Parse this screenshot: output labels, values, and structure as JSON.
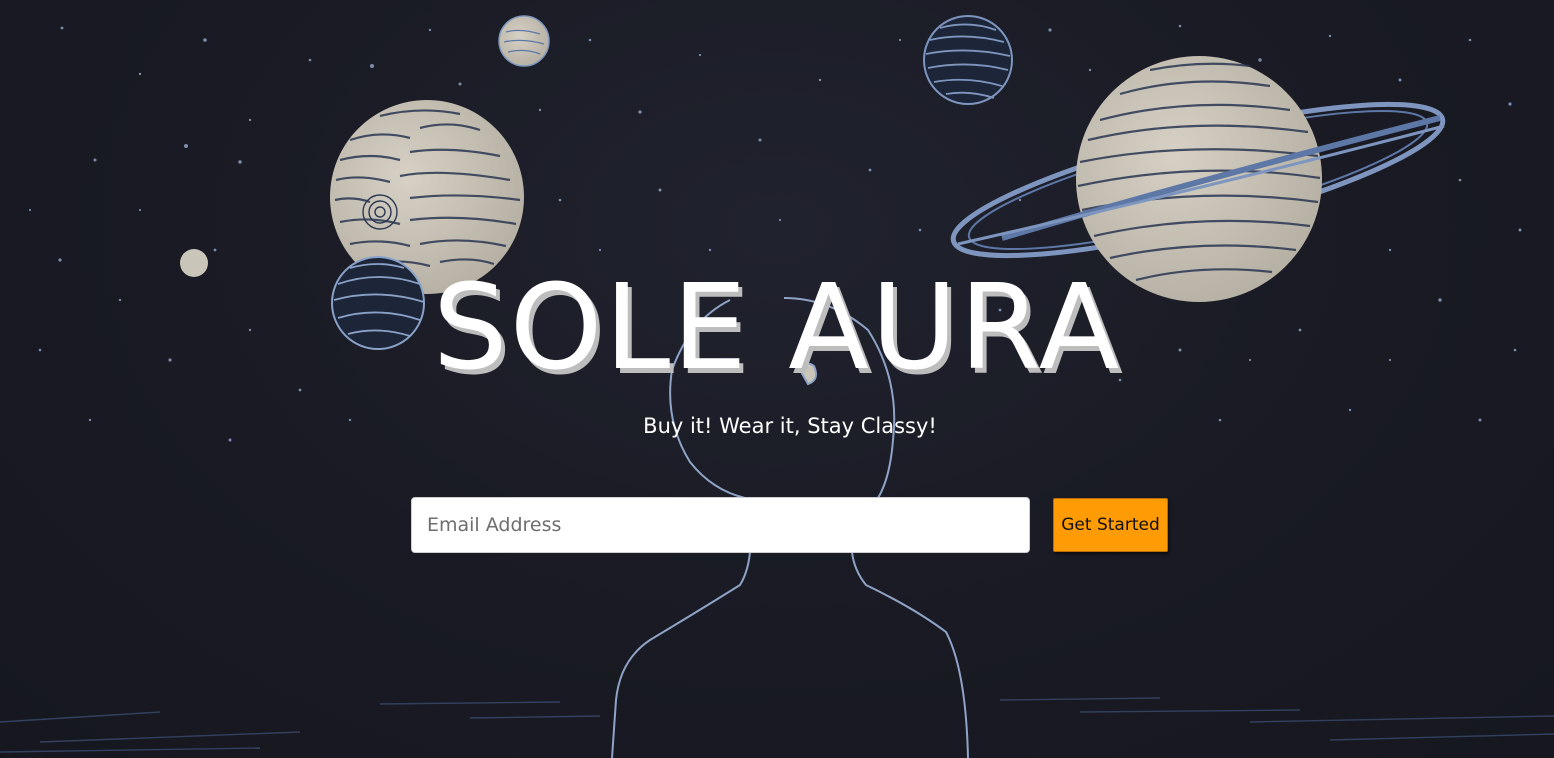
{
  "hero": {
    "title": "SOLE AURA",
    "tagline": "Buy it! Wear it, Stay Classy!",
    "email_placeholder": "Email Address",
    "cta_label": "Get Started"
  },
  "colors": {
    "background": "#181922",
    "title": "#ffffff",
    "title_shadow": "#bdbdbd",
    "cta": "#ff9b05",
    "line_art": "#7e96bf"
  },
  "background_art": {
    "description_icon": "space-planets-astronaut-illustration"
  }
}
